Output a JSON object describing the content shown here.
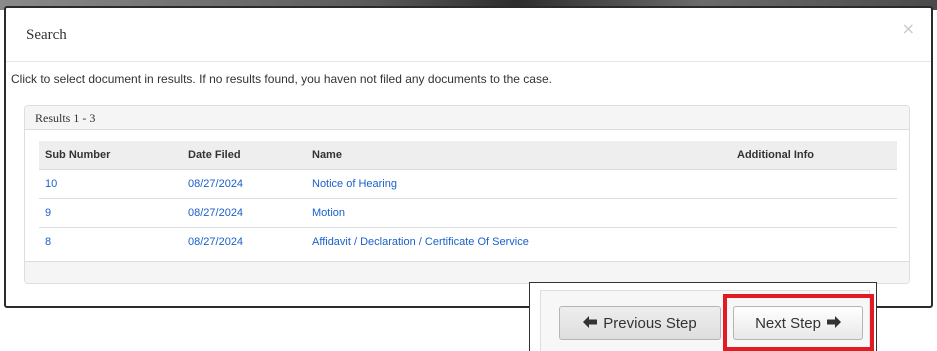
{
  "modal": {
    "title": "Search",
    "close_symbol": "×",
    "instructions": "Click to select document in results. If no results found, you haven not filed any documents to the case."
  },
  "results": {
    "heading": "Results 1 - 3",
    "columns": [
      "Sub Number",
      "Date Filed",
      "Name",
      "Additional Info"
    ],
    "rows": [
      {
        "sub_number": "10",
        "date_filed": "08/27/2024",
        "name": "Notice of Hearing",
        "additional_info": ""
      },
      {
        "sub_number": "9",
        "date_filed": "08/27/2024",
        "name": "Motion",
        "additional_info": ""
      },
      {
        "sub_number": "8",
        "date_filed": "08/27/2024",
        "name": "Affidavit / Declaration / Certificate Of Service",
        "additional_info": ""
      }
    ]
  },
  "navigation": {
    "previous_label": "Previous Step",
    "previous_icon": "arrow-left-icon",
    "next_label": "Next Step",
    "next_icon": "arrow-right-icon"
  },
  "colors": {
    "link": "#1a5fcc",
    "highlight": "#e01b24"
  }
}
